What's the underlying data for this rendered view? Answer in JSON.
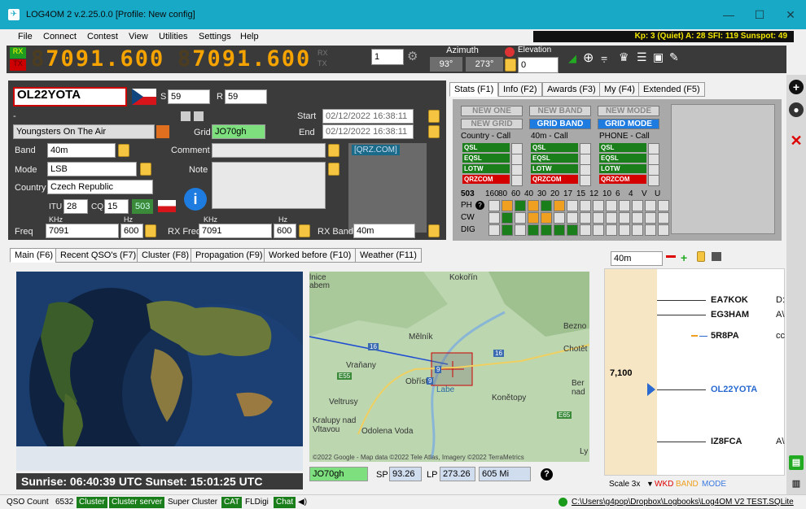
{
  "window": {
    "title": "LOG4OM 2 v.2.25.0.0 [Profile: New config]",
    "min": "—",
    "max": "☐",
    "close": "✕"
  },
  "menu": [
    "File",
    "Connect",
    "Contest",
    "View",
    "Utilities",
    "Settings",
    "Help"
  ],
  "solar": "Kp: 3 (Quiet)  A: 28  SFI: 119  Sunspot: 49",
  "vfo": {
    "rx_label": "RX",
    "tx_label": "TX",
    "ghost": "8",
    "freq_a": "7091.600",
    "freq_b": "7091.600",
    "small_rx": "RX",
    "small_tx": "TX",
    "spin_value": "1",
    "azimuth_label": "Azimuth",
    "az_sp": "93°",
    "az_lp": "273°",
    "elevation_label": "Elevation",
    "elevation_value": "0"
  },
  "qso": {
    "callsign": "OL22YOTA",
    "s_label": "S",
    "s_value": "59",
    "r_label": "R",
    "r_value": "59",
    "name": "Youngsters On The Air",
    "grid_label": "Grid",
    "grid": "JO70gh",
    "start_label": "Start",
    "start": "02/12/2022 16:38:11",
    "end_label": "End",
    "end": "02/12/2022 16:38:11",
    "band_label": "Band",
    "band": "40m",
    "comment_label": "Comment",
    "mode_label": "Mode",
    "mode": "LSB",
    "note_label": "Note",
    "country_label": "Country",
    "country": "Czech Republic",
    "itu_label": "ITU",
    "itu": "28",
    "cq_label": "CQ",
    "cq": "15",
    "dxcc": "503",
    "qrz": "[QRZ.COM]",
    "khz_label": "KHz",
    "hz_label": "Hz",
    "freq_label": "Freq",
    "freq_khz": "7091",
    "freq_hz": "600",
    "rxfreq_label": "RX Freq",
    "rxfreq_khz": "7091",
    "rxfreq_hz": "600",
    "rxband_label": "RX Band",
    "rxband": "40m"
  },
  "stats_tabs": [
    "Stats (F1)",
    "Info (F2)",
    "Awards (F3)",
    "My (F4)",
    "Extended (F5)"
  ],
  "stats": {
    "btns": [
      "NEW ONE",
      "NEW BAND",
      "NEW MODE",
      "NEW GRID",
      "GRID BAND",
      "GRID MODE"
    ],
    "col_titles": [
      "Country - Call",
      "40m - Call",
      "PHONE - Call"
    ],
    "rows": [
      "QSL",
      "EQSL",
      "LOTW",
      "QRZCOM"
    ],
    "dxcc": "503",
    "bands": [
      "160",
      "80",
      "60",
      "40",
      "30",
      "20",
      "17",
      "15",
      "12",
      "10",
      "6",
      "4",
      "V",
      "U"
    ],
    "modes": [
      "PH",
      "CW",
      "DIG"
    ],
    "help": "?"
  },
  "main_tabs": [
    "Main (F6)",
    "Recent QSO's (F7)",
    "Cluster (F8)",
    "Propagation (F9)",
    "Worked before (F10)",
    "Weather (F11)"
  ],
  "sun": "Sunrise: 06:40:39 UTC  Sunset: 15:01:25 UTC",
  "map": {
    "places": [
      "Mělník",
      "Vraňany",
      "Obříství",
      "Veltrusy",
      "Kralupy nad Vltavou",
      "Odolena Voda",
      "Konětopy",
      "Kokořín",
      "Bezno",
      "Chotět",
      "Labe",
      "Ber nad"
    ],
    "credit": "©2022 Google - Map data ©2022 Tele Atlas, Imagery ©2022 TerraMetrics",
    "roads": [
      "16",
      "16",
      "9",
      "E55",
      "9",
      "E65"
    ],
    "partial": [
      "lnice",
      "abem",
      "Ly"
    ]
  },
  "bottom": {
    "grid": "JO70gh",
    "sp_label": "SP",
    "sp": "93.26",
    "lp_label": "LP",
    "lp": "273.26",
    "dist": "605 Mi"
  },
  "bandmap": {
    "band": "40m",
    "freq_label": "7,100",
    "spots": [
      {
        "call": "EA7KOK",
        "tail": "D:"
      },
      {
        "call": "EG3HAM",
        "tail": "A\\"
      },
      {
        "call": "5R8PA",
        "tail": "cc"
      },
      {
        "call": "OL22YOTA",
        "tail": ""
      },
      {
        "call": "IZ8FCA",
        "tail": "A\\"
      }
    ],
    "scale": "Scale 3x",
    "legend": [
      "WKD",
      "BAND",
      "MODE"
    ]
  },
  "status": {
    "qso_count_label": "QSO Count",
    "qso_count": "6532",
    "items": [
      "Cluster",
      "Cluster server",
      "Super Cluster",
      "CAT",
      "FLDigi",
      "Chat"
    ],
    "db": "C:\\Users\\g4pop\\Dropbox\\Logbooks\\Log4OM V2 TEST.SQLite"
  }
}
